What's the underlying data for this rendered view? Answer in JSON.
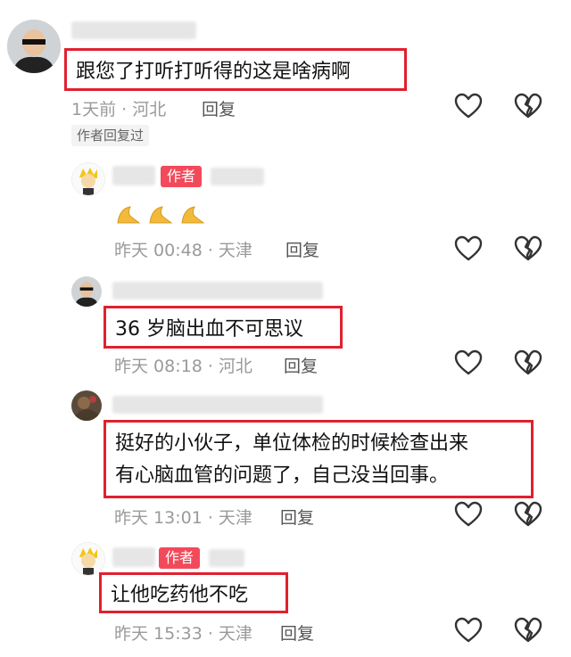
{
  "comments": [
    {
      "text": "跟您了打听打听得的这是啥病啊",
      "time": "1天前 · 河北",
      "reply": "回复",
      "tag": "作者回复过"
    },
    {
      "badge": "作者",
      "time": "昨天 00:48 · 天津",
      "reply": "回复"
    },
    {
      "text": "36 岁脑出血不可思议",
      "time": "昨天 08:18 · 河北",
      "reply": "回复"
    },
    {
      "text_line1": "挺好的小伙子，单位体检的时候检查出来",
      "text_line2": "有心脑血管的问题了，自己没当回事。",
      "time": "昨天 13:01 · 天津",
      "reply": "回复"
    },
    {
      "badge": "作者",
      "text": "让他吃药他不吃",
      "time": "昨天 15:33 · 天津",
      "reply": "回复"
    }
  ],
  "icons": {
    "like": "heart-outline-icon",
    "dislike": "broken-heart-icon"
  },
  "colors": {
    "highlight_border": "#e0202e",
    "author_badge": "#f24a5a",
    "meta_text": "#9a9a9a"
  }
}
